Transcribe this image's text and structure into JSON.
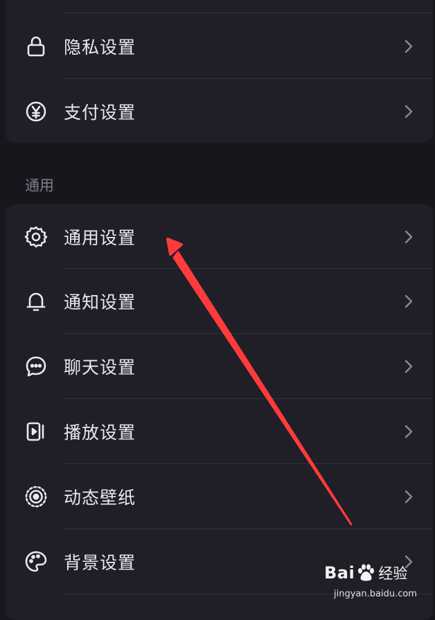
{
  "top_group": [
    {
      "label": "隐私设置",
      "icon": "lock-icon"
    },
    {
      "label": "支付设置",
      "icon": "yen-icon"
    }
  ],
  "section": {
    "title": "通用"
  },
  "general_group": [
    {
      "label": "通用设置",
      "icon": "gear-icon"
    },
    {
      "label": "通知设置",
      "icon": "bell-icon"
    },
    {
      "label": "聊天设置",
      "icon": "chat-icon"
    },
    {
      "label": "播放设置",
      "icon": "play-icon"
    },
    {
      "label": "动态壁纸",
      "icon": "dynamic-wallpaper-icon"
    },
    {
      "label": "背景设置",
      "icon": "palette-icon"
    }
  ],
  "watermark": {
    "brand_left": "Bai",
    "brand_right": "经验",
    "url": "jingyan.baidu.com"
  },
  "colors": {
    "background": "#17161c",
    "card": "#201f27",
    "text": "#e9e9ee",
    "arrow": "#ff3b3b"
  }
}
